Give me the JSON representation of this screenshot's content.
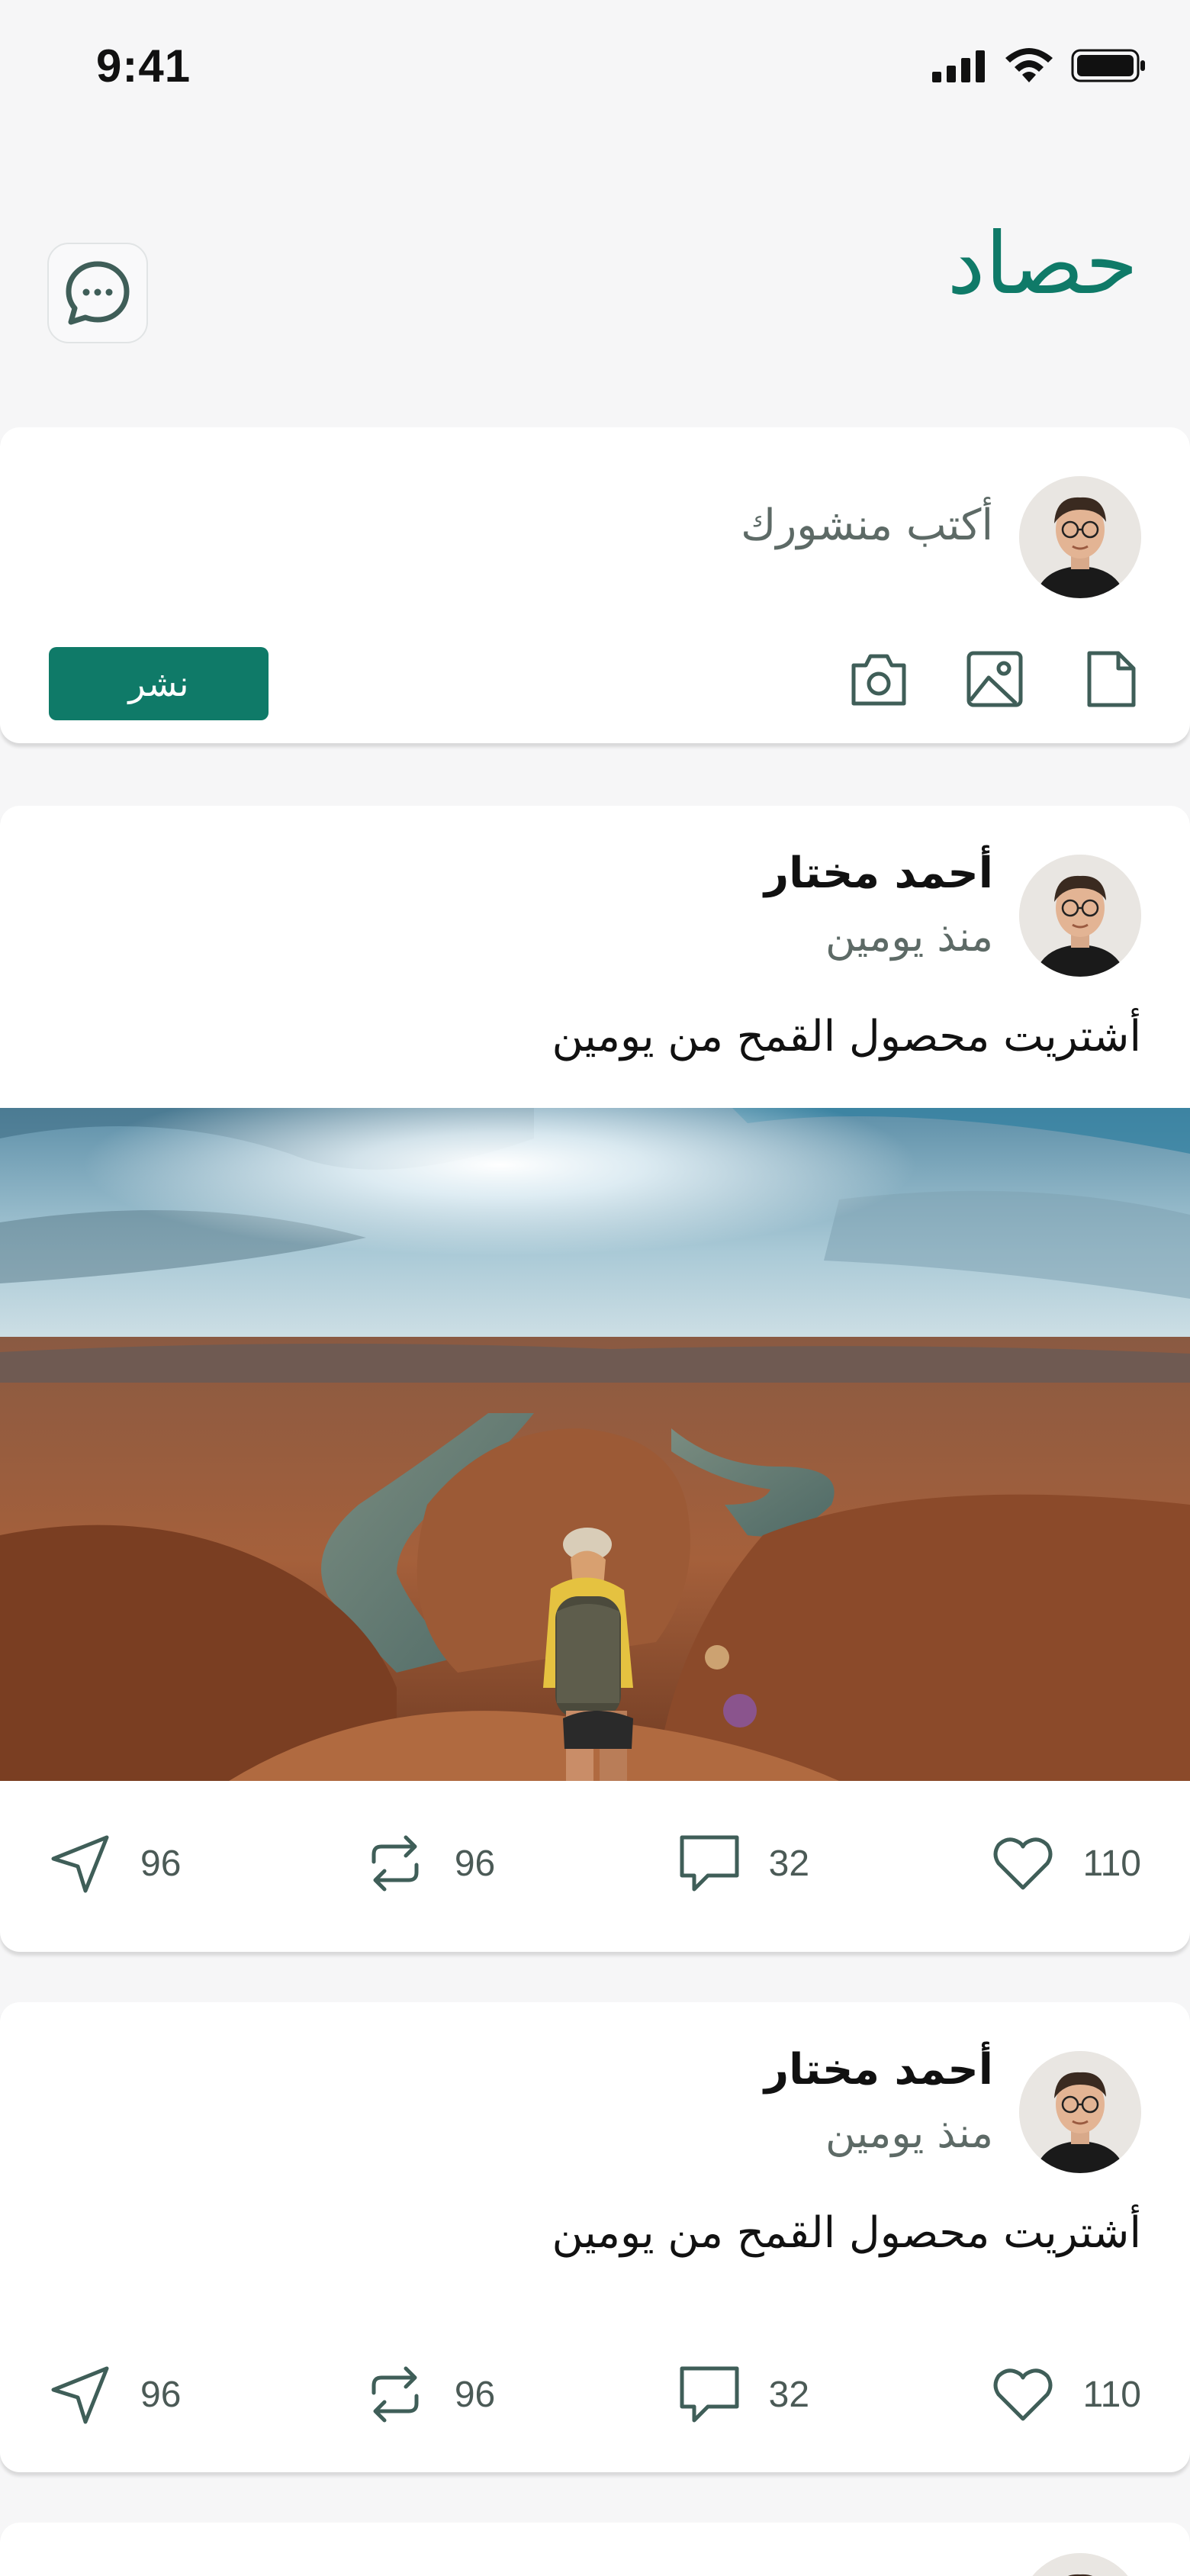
{
  "status_bar": {
    "time": "9:41",
    "icons": [
      "cellular-signal-icon",
      "wifi-icon",
      "battery-icon"
    ]
  },
  "header": {
    "title": "حصاد",
    "messages_icon": "chat-bubble-dots-icon"
  },
  "composer": {
    "placeholder": "أكتب منشورك",
    "publish_label": "نشر",
    "tools": [
      "document-icon",
      "image-icon",
      "camera-icon"
    ]
  },
  "posts": [
    {
      "author": "أحمد مختار",
      "time": "منذ يومين",
      "text": "أشتريت محصول القمح من يومين",
      "has_image": true,
      "likes": "110",
      "comments": "32",
      "reposts": "96",
      "shares": "96"
    },
    {
      "author": "أحمد مختار",
      "time": "منذ يومين",
      "text": "أشتريت محصول القمح من يومين",
      "has_image": false,
      "likes": "110",
      "comments": "32",
      "reposts": "96",
      "shares": "96"
    }
  ],
  "colors": {
    "brand": "#0f7a68",
    "background": "#f6f6f7",
    "icon": "#3f5e58"
  }
}
